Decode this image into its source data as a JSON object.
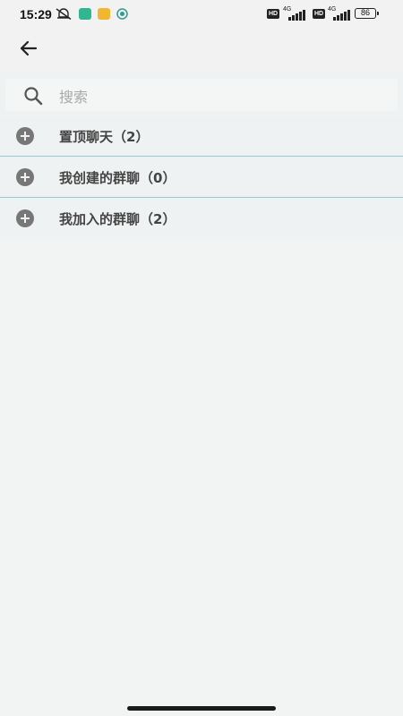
{
  "status_bar": {
    "time": "15:29",
    "battery": "86",
    "hd": "HD",
    "network": "4G"
  },
  "header": {
    "back_icon": "arrow-left-icon"
  },
  "search": {
    "placeholder": "搜索",
    "value": "",
    "icon": "search-icon"
  },
  "groups": [
    {
      "label": "置顶聊天（2）",
      "icon": "plus-circle-icon"
    },
    {
      "label": "我创建的群聊（0）",
      "icon": "plus-circle-icon"
    },
    {
      "label": "我加入的群聊（2）",
      "icon": "plus-circle-icon"
    }
  ],
  "colors": {
    "background": "#f2f4f4",
    "divider": "#9cc6d2",
    "icon_gray": "#777777"
  }
}
